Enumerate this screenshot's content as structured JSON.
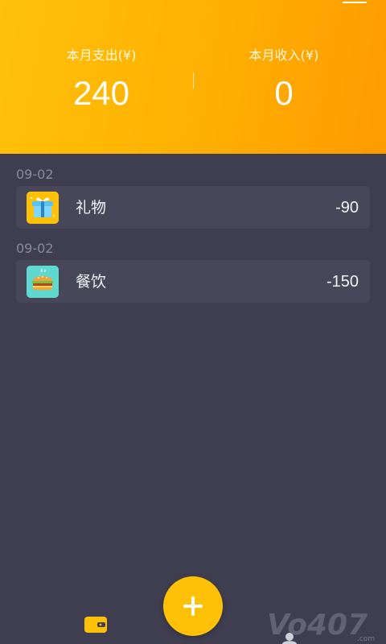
{
  "header": {
    "expense_label": "本月支出(¥)",
    "expense_value": "240",
    "income_label": "本月收入(¥)",
    "income_value": "0",
    "menu_icon": "menu-icon",
    "gradient_start": "#ffc10a",
    "gradient_end": "#ff9b00"
  },
  "records": [
    {
      "date": "09-02",
      "category": "礼物",
      "amount": "-90",
      "icon": "gift-icon",
      "icon_bg": "#ffc107"
    },
    {
      "date": "09-02",
      "category": "餐饮",
      "amount": "-150",
      "icon": "burger-icon",
      "icon_bg": "#5fd8cf"
    }
  ],
  "fab": {
    "icon": "plus-icon",
    "color": "#ffc107"
  },
  "bottom_nav": {
    "home_icon": "wallet-icon",
    "mine_icon": "person-icon"
  },
  "colors": {
    "background": "#3e3e50",
    "card": "#474759",
    "accent": "#ffc107"
  }
}
